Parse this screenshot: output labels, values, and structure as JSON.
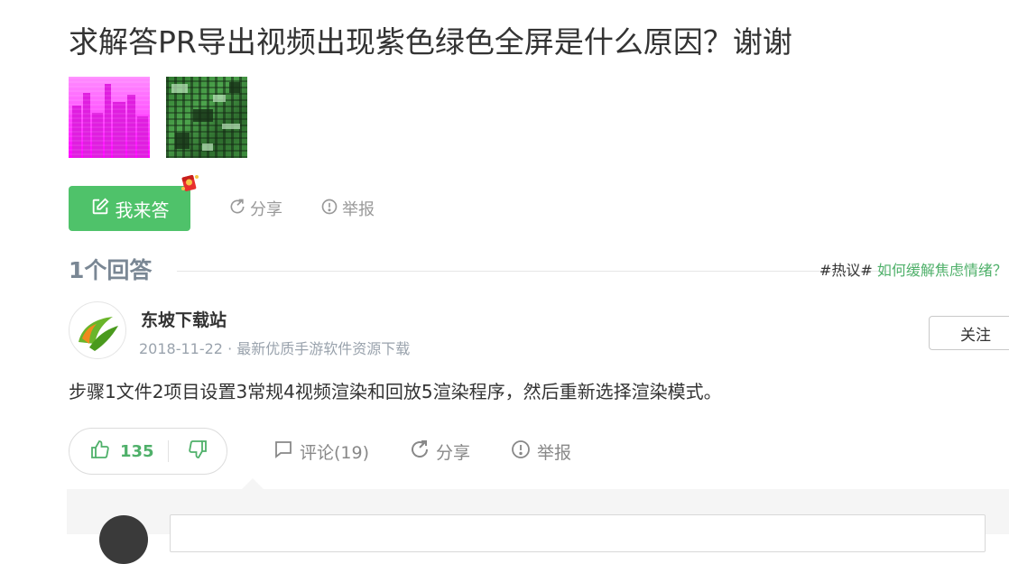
{
  "question": {
    "title": "求解答PR导出视频出现紫色绿色全屏是什么原因？谢谢",
    "images": [
      {
        "name": "magenta-city-image"
      },
      {
        "name": "green-circuit-image"
      }
    ]
  },
  "actions": {
    "answer_label": "我来答",
    "share_label": "分享",
    "report_label": "举报"
  },
  "answers_header": {
    "count_label": "1个回答",
    "hot_tag": "#热议#",
    "hot_link": "如何缓解焦虑情绪？"
  },
  "answer": {
    "author_name": "东坡下载站",
    "author_meta": "2018-11-22 · 最新优质手游软件资源下载",
    "follow_label": "关注",
    "text": "步骤1文件2项目设置3常规4视频渲染和回放5渲染程序，然后重新选择渲染模式。",
    "upvotes": "135",
    "comment_label": "评论(19)",
    "share_label": "分享",
    "report_label": "举报"
  },
  "colors": {
    "accent_green": "#4fc26a",
    "link_green": "#4fb06a",
    "muted": "#999999"
  }
}
